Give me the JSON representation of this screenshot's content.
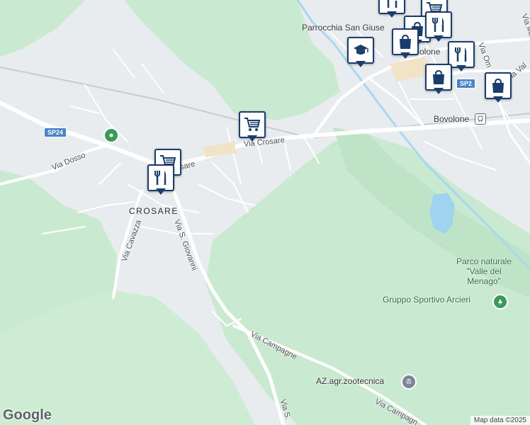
{
  "map": {
    "labels": {
      "via_crosare_1": "Via Crosare",
      "via_crosare_2": "sare",
      "via_dosso": "Via Dosso",
      "via_cavazza": "Via Cavazza",
      "via_s_giovanni_1": "Via S. Giovanni",
      "via_s_giovanni_2": "Via S.",
      "via_campagne_1": "Via Campagne",
      "via_campagne_2": "Via Campagn",
      "via_ma": "Via Ma",
      "via_val": "Via Val",
      "via_om": "Via Om",
      "sp24": "SP24",
      "sp2": "SP2",
      "crosare": "CROSARE",
      "bovolone_town": "olone",
      "bovolone_station": "Bovolone",
      "parrocchia": "Parrocchia San Giuse",
      "parco_line1": "Parco naturale",
      "parco_line2": "\"Valle del",
      "parco_line3": "Menago\"",
      "gruppo_sportivo": "Gruppo Sportivo Arcieri",
      "az_agr": "AZ.agr.zootecnica"
    },
    "markers": [
      {
        "id": "cart-crosare",
        "icon": "shopping-cart-icon"
      },
      {
        "id": "cart-crosare-west",
        "icon": "shopping-cart-icon"
      },
      {
        "id": "restaurant-crosare",
        "icon": "restaurant-icon"
      },
      {
        "id": "school-bovolone",
        "icon": "school-icon"
      },
      {
        "id": "shop-bovolone-1",
        "icon": "shopping-bag-icon"
      },
      {
        "id": "restaurant-bovolone-1",
        "icon": "restaurant-icon"
      },
      {
        "id": "restaurant-bovolone-2",
        "icon": "restaurant-icon"
      },
      {
        "id": "shop-bovolone-2",
        "icon": "shopping-bag-icon"
      },
      {
        "id": "shop-bovolone-3",
        "icon": "shopping-bag-icon"
      },
      {
        "id": "cart-bovolone",
        "icon": "shopping-cart-icon"
      }
    ],
    "colors": {
      "green_area": "#c6e8cc",
      "urban": "#e8ecef",
      "marker_border": "#1a3d6e",
      "water": "#9fd3f0",
      "shield": "#4a84c8"
    },
    "attribution": "Map data ©2025",
    "logo": "Google"
  }
}
